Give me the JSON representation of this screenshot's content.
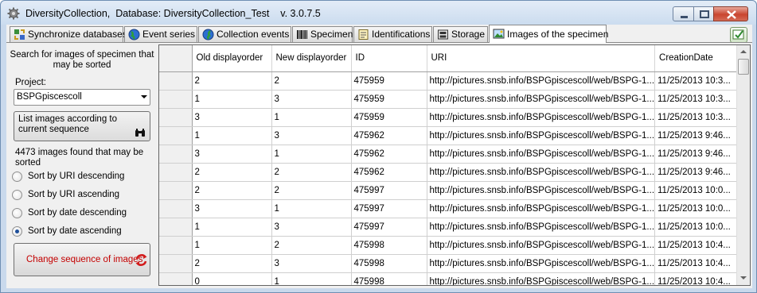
{
  "window": {
    "title": "DiversityCollection,  Database: DiversityCollection_Test    v. 3.0.7.5"
  },
  "tabs": [
    {
      "label": "Synchronize databases",
      "icon": "sync-icon"
    },
    {
      "label": "Event series",
      "icon": "globe-icon"
    },
    {
      "label": "Collection events",
      "icon": "globe-icon"
    },
    {
      "label": "Specimen",
      "icon": "barcode-icon"
    },
    {
      "label": "Identifications",
      "icon": "notepad-icon"
    },
    {
      "label": "Storage",
      "icon": "storage-icon"
    },
    {
      "label": "Images of the specimen",
      "icon": "picture-icon",
      "active": true
    }
  ],
  "left_panel": {
    "search_hint": "Search for images of specimen that may be sorted",
    "project_label": "Project:",
    "project_value": "BSPGpiscescoll",
    "list_button_label": "List images according to current sequence",
    "found_text": "4473 images found that may be sorted",
    "sort_options": [
      {
        "label": "Sort by URI descending",
        "checked": false
      },
      {
        "label": "Sort by URI ascending",
        "checked": false
      },
      {
        "label": "Sort by date descending",
        "checked": false
      },
      {
        "label": "Sort by date ascending",
        "checked": true
      }
    ],
    "change_button_label": "Change sequence of images"
  },
  "grid": {
    "columns": [
      "Old displayorder",
      "New displayorder",
      "ID",
      "URI",
      "CreationDate"
    ],
    "rows": [
      [
        "2",
        "2",
        "475959",
        "http://pictures.snsb.info/BSPGpiscescoll/web/BSPG-1...",
        "11/25/2013 10:3..."
      ],
      [
        "1",
        "3",
        "475959",
        "http://pictures.snsb.info/BSPGpiscescoll/web/BSPG-1...",
        "11/25/2013 10:3..."
      ],
      [
        "3",
        "1",
        "475959",
        "http://pictures.snsb.info/BSPGpiscescoll/web/BSPG-1...",
        "11/25/2013 10:3..."
      ],
      [
        "1",
        "3",
        "475962",
        "http://pictures.snsb.info/BSPGpiscescoll/web/BSPG-1...",
        "11/25/2013 9:46..."
      ],
      [
        "3",
        "1",
        "475962",
        "http://pictures.snsb.info/BSPGpiscescoll/web/BSPG-1...",
        "11/25/2013 9:46..."
      ],
      [
        "2",
        "2",
        "475962",
        "http://pictures.snsb.info/BSPGpiscescoll/web/BSPG-1...",
        "11/25/2013 9:46..."
      ],
      [
        "2",
        "2",
        "475997",
        "http://pictures.snsb.info/BSPGpiscescoll/web/BSPG-1...",
        "11/25/2013 10:0..."
      ],
      [
        "3",
        "1",
        "475997",
        "http://pictures.snsb.info/BSPGpiscescoll/web/BSPG-1...",
        "11/25/2013 10:0..."
      ],
      [
        "1",
        "3",
        "475997",
        "http://pictures.snsb.info/BSPGpiscescoll/web/BSPG-1...",
        "11/25/2013 10:0..."
      ],
      [
        "1",
        "2",
        "475998",
        "http://pictures.snsb.info/BSPGpiscescoll/web/BSPG-1...",
        "11/25/2013 10:4..."
      ],
      [
        "2",
        "3",
        "475998",
        "http://pictures.snsb.info/BSPGpiscescoll/web/BSPG-1...",
        "11/25/2013 10:4..."
      ],
      [
        "0",
        "1",
        "475998",
        "http://pictures.snsb.info/BSPGpiscescoll/web/BSPG-1...",
        "11/25/2013 10:4..."
      ]
    ]
  }
}
